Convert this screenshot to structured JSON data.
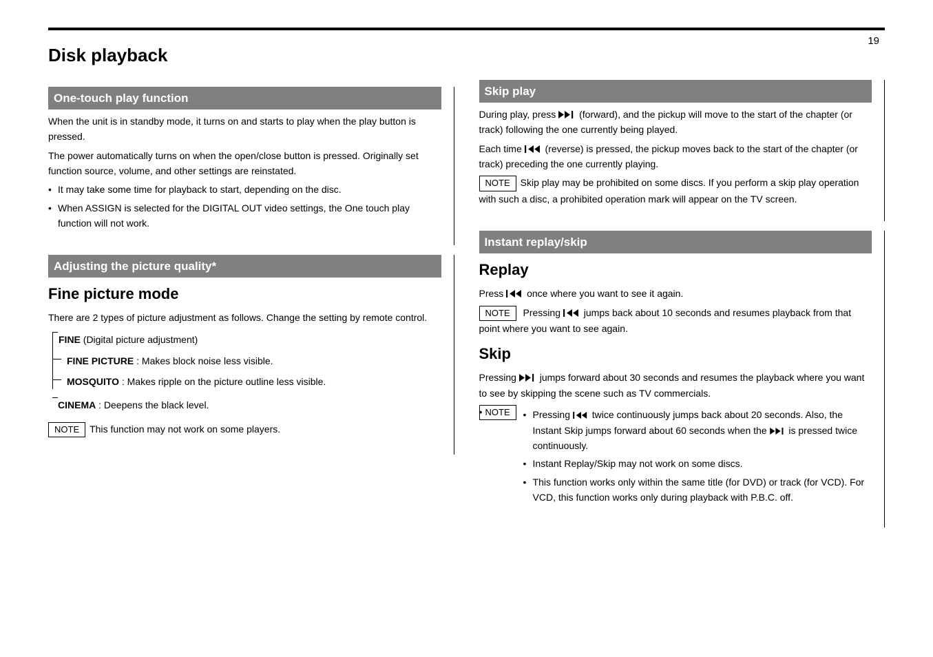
{
  "pagenum": "19",
  "main_title": "Disk playback",
  "L": {
    "s1": {
      "head": "One-touch play function",
      "p1": "When the unit is in standby mode, it turns on and starts to play when the play button is pressed.",
      "p2": "The power automatically turns on when the open/close button is pressed. Originally set function source, volume, and other settings are reinstated.",
      "b1": "It may take some time for playback to start, depending on the disc.",
      "b2": "When ASSIGN is selected for the DIGITAL OUT video settings, the One touch play function will not work."
    },
    "s2": {
      "head": "Adjusting the picture quality",
      "asterisk": "*",
      "big": "Fine picture mode",
      "p1": "There are 2 types of picture adjustment as follows. Change the setting by remote control.",
      "t_fine": {
        "title": "FINE",
        "desc": "(Digital picture adjustment)"
      },
      "t_fp": {
        "title": "FINE PICTURE",
        "desc": "Makes block noise less visible."
      },
      "t_mo": {
        "title": "MOSQUITO",
        "desc": "Makes ripple on the picture outline less visible."
      },
      "t_cine": {
        "title": "CINEMA",
        "desc": "Deepens the black level."
      },
      "note": "This function may not work on some players."
    }
  },
  "R": {
    "s1": {
      "head": "Skip play",
      "p1_a": "During play, press ",
      "p1_b": " (forward), and the pickup will move to the start of the chapter (or track) following the one currently being played.",
      "p2_a": "Each time ",
      "p2_b": " (reverse) is pressed, the pickup moves back to the start of the chapter (or track) preceding the one currently playing.",
      "note": "Skip play may be prohibited on some discs. If you perform a skip play operation with such a disc, a prohibited operation mark will appear on the TV screen."
    },
    "s2": {
      "head": "Instant replay/skip",
      "big": "Replay",
      "a1": "Press ",
      "a2": " once where you want to see it again.",
      "a3_a": "Pressing ",
      "a3_b": " jumps back about 10 seconds and resumes playback from that point where you want to see again.",
      "big2": "Skip",
      "b1_a": "Pressing ",
      "b1_b": " jumps forward about 30 seconds and resumes the playback where you want to see by skipping the scene such as TV commercials.",
      "note_a": "Pressing ",
      "note_b": " twice continuously jumps back about 20 seconds. Also, the Instant Skip jumps forward about 60 seconds when the ",
      "note_c": " is pressed twice continuously.",
      "note2": "Instant Replay/Skip may not work on some discs.",
      "note3": "This function works only within the same title (for DVD) or track (for VCD). For VCD, this function works only during playback with P.B.C. off."
    }
  },
  "lbl_note": "NOTE"
}
